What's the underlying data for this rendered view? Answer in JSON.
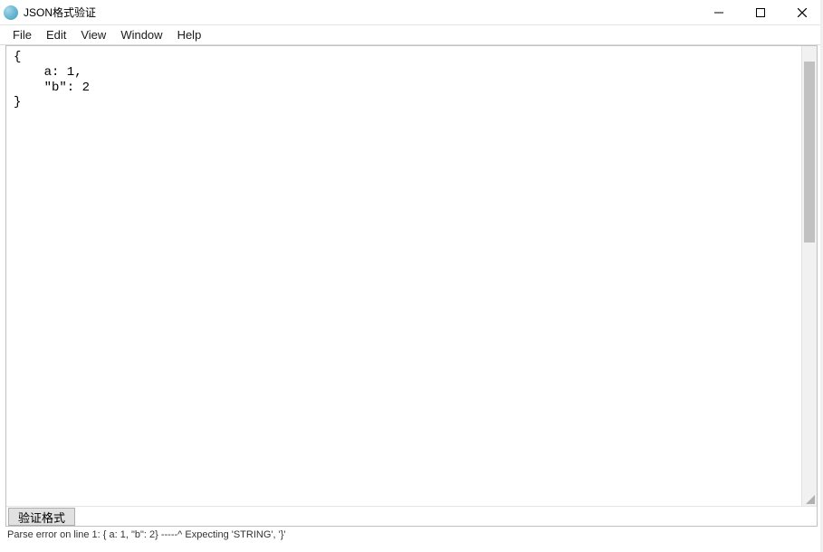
{
  "window": {
    "title": "JSON格式验证"
  },
  "menu": {
    "file": "File",
    "edit": "Edit",
    "view": "View",
    "window": "Window",
    "help": "Help"
  },
  "editor": {
    "content": "{\n    a: 1,\n    \"b\": 2\n}"
  },
  "actions": {
    "verify": "验证格式"
  },
  "status": {
    "message": "Parse error on line 1: { a: 1, \"b\": 2} -----^ Expecting 'STRING', '}'"
  }
}
